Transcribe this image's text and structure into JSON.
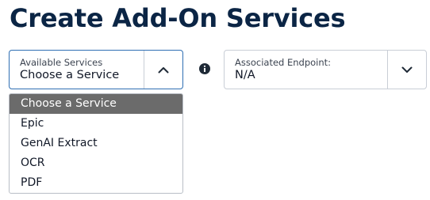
{
  "page": {
    "title": "Create Add-On Services"
  },
  "services_select": {
    "label": "Available Services",
    "value": "Choose a Service",
    "expanded": true,
    "toggle_icon": "chevron-up-icon",
    "options": [
      {
        "label": "Choose a Service",
        "selected": true
      },
      {
        "label": "Epic",
        "selected": false
      },
      {
        "label": "GenAI Extract",
        "selected": false
      },
      {
        "label": "OCR",
        "selected": false
      },
      {
        "label": "PDF",
        "selected": false
      }
    ]
  },
  "info_icon": "info-icon",
  "endpoint_select": {
    "label": "Associated Endpoint:",
    "value": "N/A",
    "expanded": false,
    "toggle_icon": "chevron-down-icon"
  },
  "colors": {
    "title": "#0b2545",
    "focus_border": "#2f6fb3",
    "border": "#c9ced6",
    "selected_option_bg": "#6b6b6b",
    "info_icon": "#1f2a37"
  }
}
